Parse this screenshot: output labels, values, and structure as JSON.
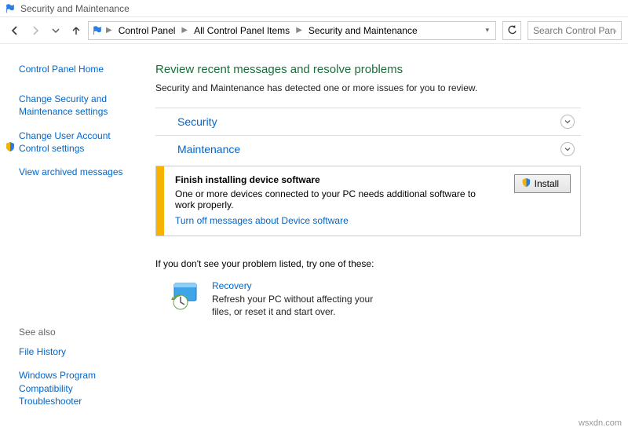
{
  "window": {
    "title": "Security and Maintenance"
  },
  "breadcrumb": {
    "items": [
      "Control Panel",
      "All Control Panel Items",
      "Security and Maintenance"
    ]
  },
  "search": {
    "placeholder": "Search Control Panel"
  },
  "sidebar": {
    "home": "Control Panel Home",
    "links": {
      "change_security": "Change Security and Maintenance settings",
      "change_uac": "Change User Account Control settings",
      "view_archived": "View archived messages"
    },
    "see_also_heading": "See also",
    "see_also": {
      "file_history": "File History",
      "compat_troubleshooter": "Windows Program Compatibility Troubleshooter"
    }
  },
  "content": {
    "heading": "Review recent messages and resolve problems",
    "detected": "Security and Maintenance has detected one or more issues for you to review.",
    "sections": {
      "security": "Security",
      "maintenance": "Maintenance"
    },
    "alert": {
      "heading": "Finish installing device software",
      "message": "One or more devices connected to your PC needs additional software to work properly.",
      "turn_off": "Turn off messages about Device software",
      "install_button": "Install"
    },
    "prompt": "If you don't see your problem listed, try one of these:",
    "recovery": {
      "title": "Recovery",
      "desc": "Refresh your PC without affecting your files, or reset it and start over."
    }
  },
  "watermark": "wsxdn.com"
}
